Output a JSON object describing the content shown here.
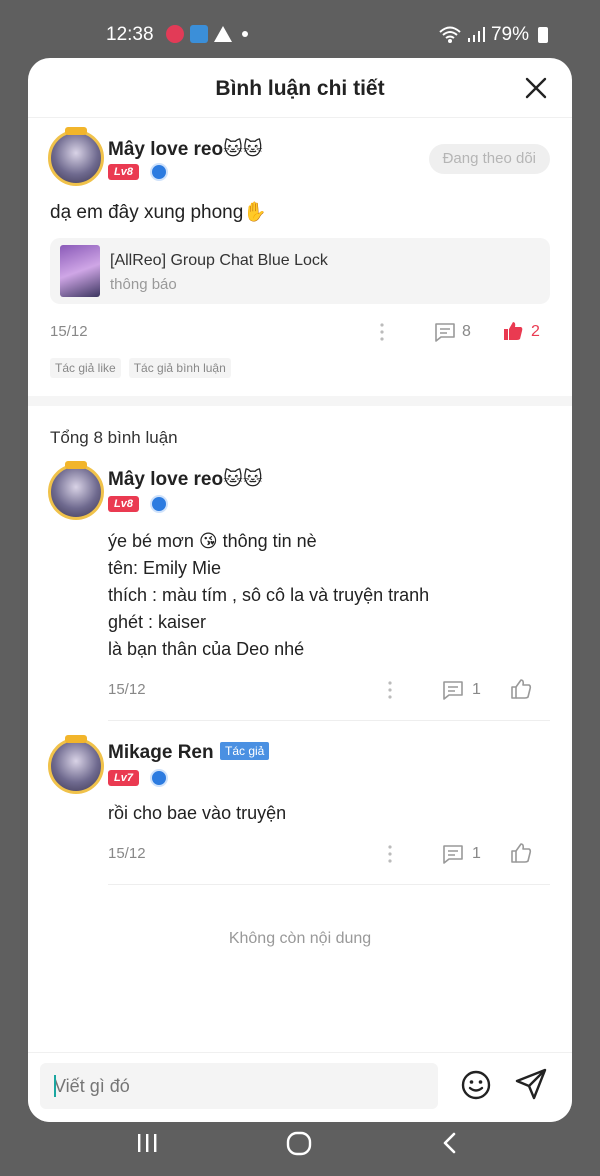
{
  "status_bar": {
    "time": "12:38",
    "battery": "79%"
  },
  "sheet": {
    "title": "Bình luận chi tiết"
  },
  "post": {
    "username": "Mây love reo🐱🐱",
    "level": "Lv8",
    "follow_label": "Đang theo dõi",
    "text": "dạ em đây xung phong✋",
    "source": {
      "title": "[AllReo] Group Chat Blue Lock",
      "subtitle": "thông báo"
    },
    "date": "15/12",
    "comment_count": "8",
    "like_count": "2",
    "tags": [
      "Tác giả like",
      "Tác giả bình luận"
    ]
  },
  "comments_header": "Tổng 8 bình luận",
  "comments": [
    {
      "username": "Mây love reo🐱🐱",
      "level": "Lv8",
      "lines": [
        "ýe bé mơn 😘 thông tin nè",
        "tên: Emily Mie",
        "thích : màu tím , sô cô la và truyện tranh",
        "ghét : kaiser",
        "là bạn thân của Deo nhé"
      ],
      "date": "15/12",
      "reply_count": "1"
    },
    {
      "username": "Mikage Ren",
      "author_tag": "Tác giả",
      "level": "Lv7",
      "lines": [
        "rồi cho bae vào truyện"
      ],
      "date": "15/12",
      "reply_count": "1"
    }
  ],
  "end_text": "Không còn nội dung",
  "input": {
    "placeholder": "Viết gì đó"
  },
  "colors": {
    "like_active": "#ea3a51",
    "author_tag": "#4a90e2",
    "level_badge": "#ea3a51"
  }
}
